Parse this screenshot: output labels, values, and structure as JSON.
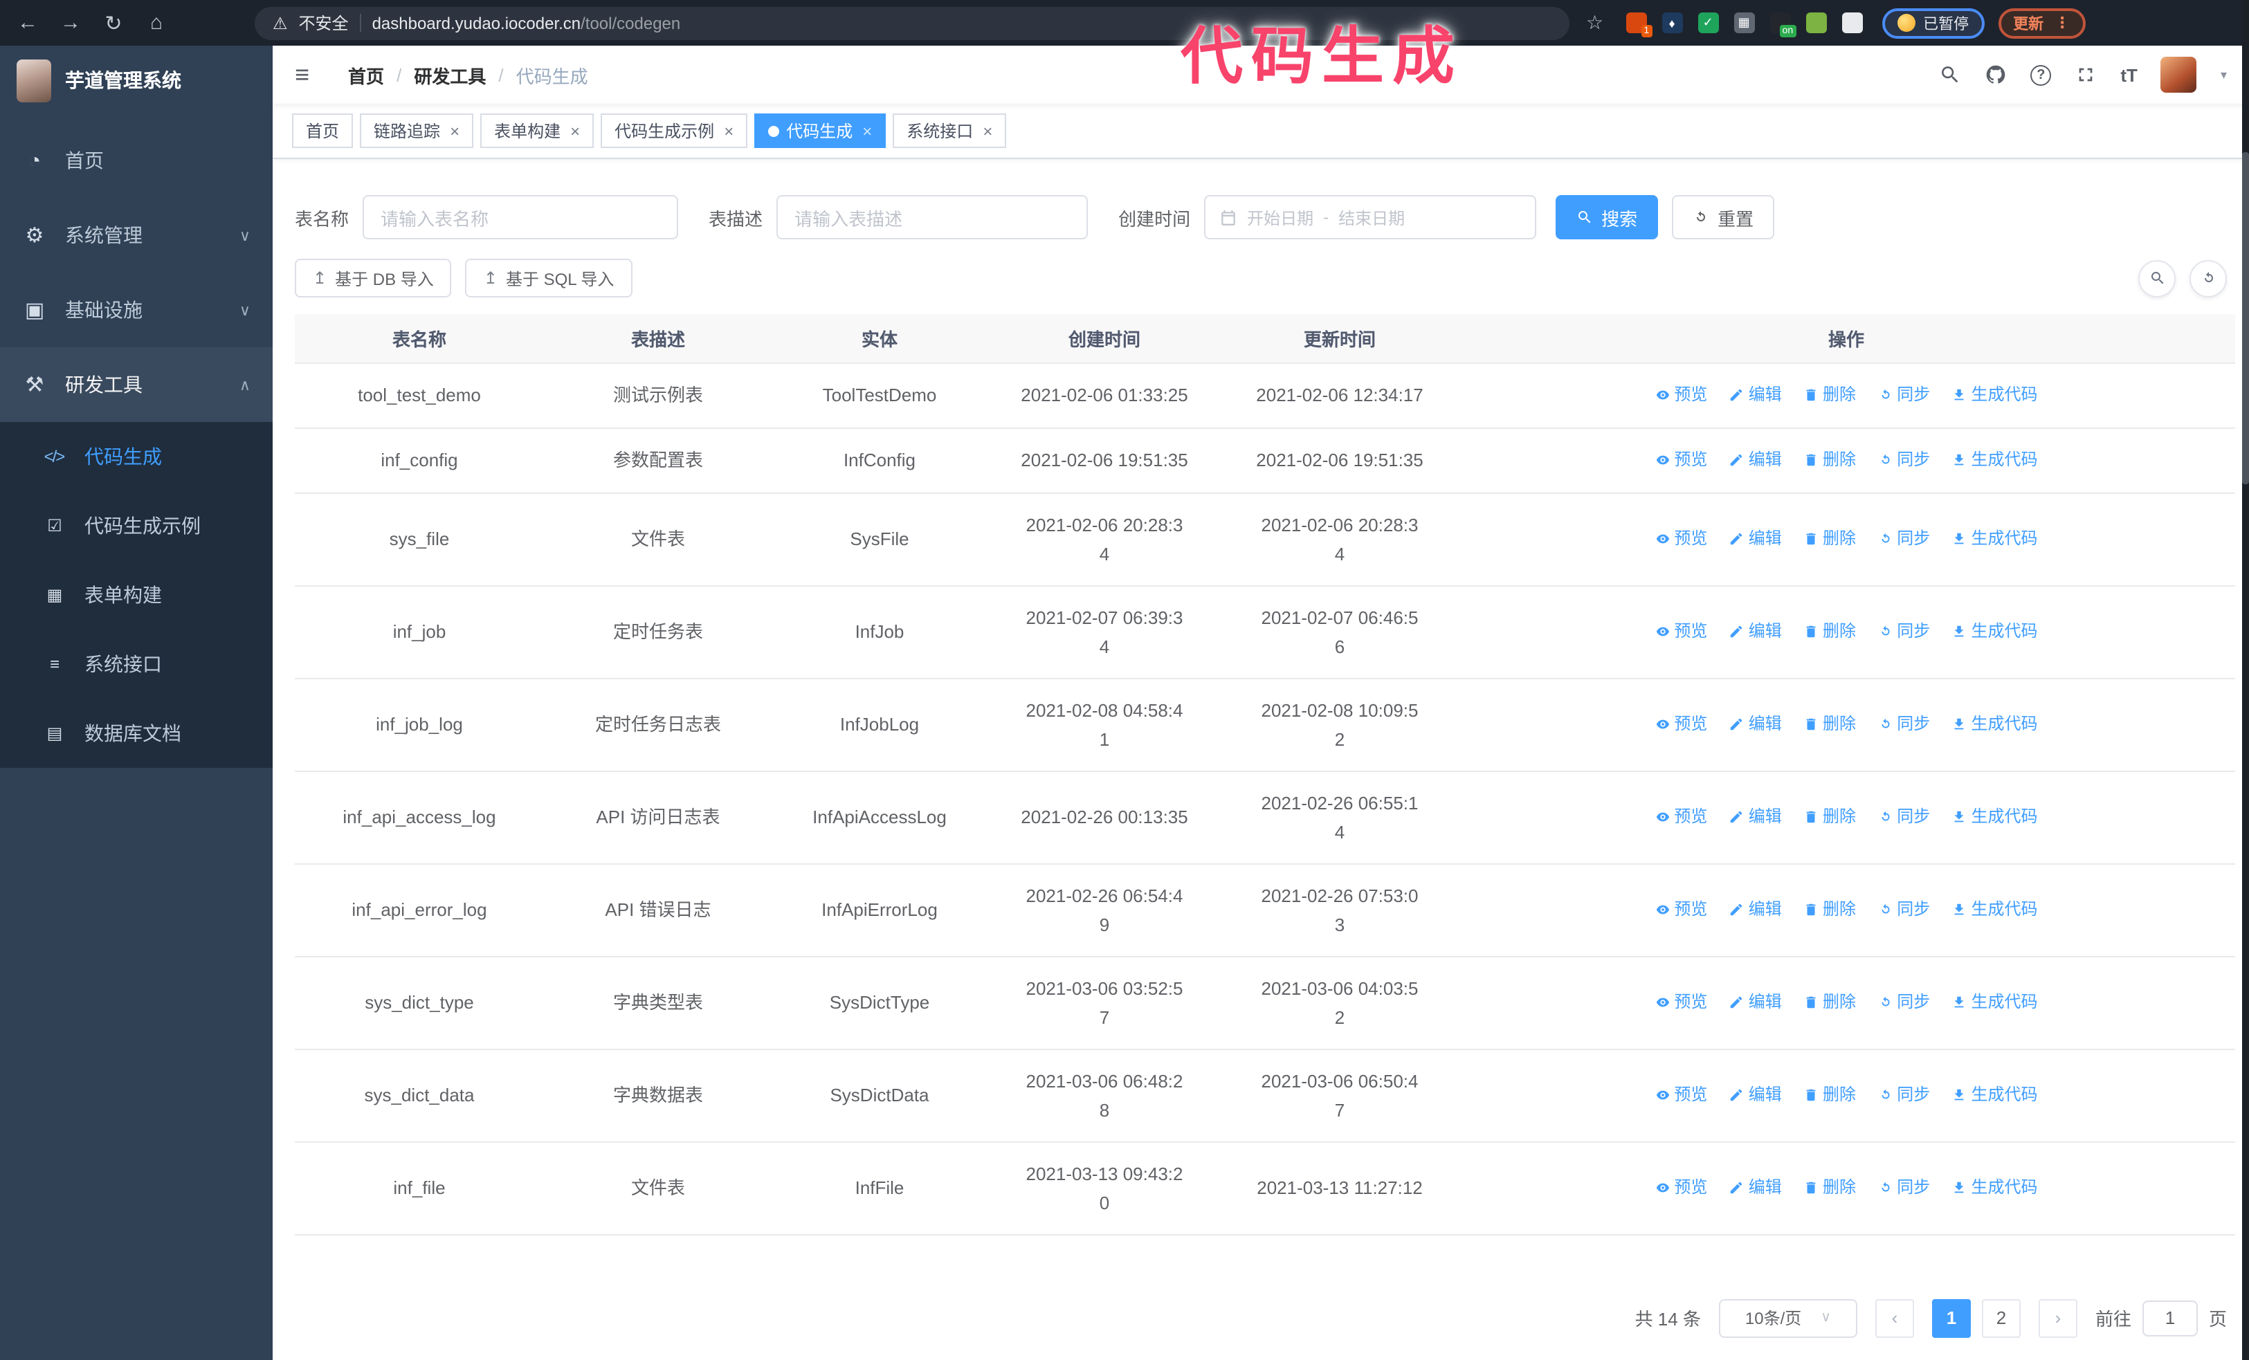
{
  "browser": {
    "security_label": "不安全",
    "url_host": "dashboard.yudao.iocoder.cn",
    "url_path": "/tool/codegen",
    "paused_badge": "已暂停",
    "update_button": "更新",
    "extensions": [
      {
        "name": "extension-loop-icon",
        "bg": "#d9480f",
        "badge": "1",
        "badge_bg": "#e8590c"
      },
      {
        "name": "extension-gem-icon",
        "bg": "#1e3a5f",
        "glyph": "♦"
      },
      {
        "name": "extension-check-icon",
        "bg": "#1fa45c",
        "glyph": "✓"
      },
      {
        "name": "extension-grid-icon",
        "bg": "#5f6772",
        "glyph": "▦"
      },
      {
        "name": "extension-on-badge-icon",
        "bg": "#23272d",
        "badge": "on",
        "badge_bg": "#2bab4e"
      },
      {
        "name": "extension-android-icon",
        "bg": "#7cb342"
      },
      {
        "name": "extension-puzzle-icon",
        "bg": "#e8eaed"
      }
    ]
  },
  "glyphs": {
    "back": "←",
    "forward": "→",
    "reload": "↻",
    "home": "⌂",
    "warning": "⚠",
    "star": "☆",
    "dots": "⋮",
    "hamburger": "≡",
    "caret_down": "▾",
    "close": "×",
    "prev": "‹",
    "next": "›",
    "select_caret": "∨",
    "upload": "↥"
  },
  "annotation": {
    "text": "代码生成",
    "color": "#f8436b"
  },
  "sidebar": {
    "logo_title": "芋道管理系统",
    "items": [
      {
        "label": "首页",
        "icon": "dashboard-icon",
        "glyph": "◔"
      },
      {
        "label": "系统管理",
        "icon": "gear-icon",
        "glyph": "⚙",
        "chevron_down": "∨"
      },
      {
        "label": "基础设施",
        "icon": "infrastructure-icon",
        "glyph": "▣",
        "chevron_down": "∨"
      },
      {
        "label": "研发工具",
        "icon": "toolbox-icon",
        "glyph": "⚒",
        "chevron_up": "∧",
        "active": true
      }
    ],
    "submenu": [
      {
        "label": "代码生成",
        "icon": "code-icon",
        "glyph": "</>",
        "active": true
      },
      {
        "label": "代码生成示例",
        "icon": "example-icon",
        "glyph": "☑"
      },
      {
        "label": "表单构建",
        "icon": "form-builder-icon",
        "glyph": "▦"
      },
      {
        "label": "系统接口",
        "icon": "api-icon",
        "glyph": "≡"
      },
      {
        "label": "数据库文档",
        "icon": "database-doc-icon",
        "glyph": "▤"
      }
    ]
  },
  "navbar": {
    "breadcrumb": [
      "首页",
      "研发工具",
      "代码生成"
    ],
    "separator": "/",
    "font_size_icon_label": "tT"
  },
  "tabs": [
    {
      "label": "首页"
    },
    {
      "label": "链路追踪",
      "closable": true
    },
    {
      "label": "表单构建",
      "closable": true
    },
    {
      "label": "代码生成示例",
      "closable": true
    },
    {
      "label": "代码生成",
      "closable": true,
      "active": true
    },
    {
      "label": "系统接口",
      "closable": true
    }
  ],
  "search_form": {
    "name_label": "表名称",
    "name_placeholder": "请输入表名称",
    "desc_label": "表描述",
    "desc_placeholder": "请输入表描述",
    "time_label": "创建时间",
    "start_placeholder": "开始日期",
    "range_separator": "-",
    "end_placeholder": "结束日期",
    "search_button": "搜索",
    "reset_button": "重置"
  },
  "toolbar": {
    "db_import_button": "基于 DB 导入",
    "sql_import_button": "基于 SQL 导入"
  },
  "table": {
    "columns": [
      "表名称",
      "表描述",
      "实体",
      "创建时间",
      "更新时间",
      "操作"
    ],
    "actions": [
      "预览",
      "编辑",
      "删除",
      "同步",
      "生成代码"
    ],
    "rows": [
      {
        "name": "tool_test_demo",
        "desc": "测试示例表",
        "entity": "ToolTestDemo",
        "created": "2021-02-06 01:33:25",
        "updated": "2021-02-06 12:34:17"
      },
      {
        "name": "inf_config",
        "desc": "参数配置表",
        "entity": "InfConfig",
        "created": "2021-02-06 19:51:35",
        "updated": "2021-02-06 19:51:35"
      },
      {
        "name": "sys_file",
        "desc": "文件表",
        "entity": "SysFile",
        "created": "2021-02-06 20:28:3\n4",
        "updated": "2021-02-06 20:28:3\n4"
      },
      {
        "name": "inf_job",
        "desc": "定时任务表",
        "entity": "InfJob",
        "created": "2021-02-07 06:39:3\n4",
        "updated": "2021-02-07 06:46:5\n6"
      },
      {
        "name": "inf_job_log",
        "desc": "定时任务日志表",
        "entity": "InfJobLog",
        "created": "2021-02-08 04:58:4\n1",
        "updated": "2021-02-08 10:09:5\n2"
      },
      {
        "name": "inf_api_access_log",
        "desc": "API 访问日志表",
        "entity": "InfApiAccessLog",
        "created": "2021-02-26 00:13:35",
        "updated": "2021-02-26 06:55:1\n4"
      },
      {
        "name": "inf_api_error_log",
        "desc": "API 错误日志",
        "entity": "InfApiErrorLog",
        "created": "2021-02-26 06:54:4\n9",
        "updated": "2021-02-26 07:53:0\n3"
      },
      {
        "name": "sys_dict_type",
        "desc": "字典类型表",
        "entity": "SysDictType",
        "created": "2021-03-06 03:52:5\n7",
        "updated": "2021-03-06 04:03:5\n2"
      },
      {
        "name": "sys_dict_data",
        "desc": "字典数据表",
        "entity": "SysDictData",
        "created": "2021-03-06 06:48:2\n8",
        "updated": "2021-03-06 06:50:4\n7"
      },
      {
        "name": "inf_file",
        "desc": "文件表",
        "entity": "InfFile",
        "created": "2021-03-13 09:43:2\n0",
        "updated": "2021-03-13 11:27:12"
      }
    ]
  },
  "pagination": {
    "total_label": "共 14 条",
    "page_size": "10条/页",
    "pages": [
      {
        "label": "1",
        "active": true
      },
      {
        "label": "2"
      }
    ],
    "goto_label": "前往",
    "goto_value": "1",
    "goto_suffix": "页"
  },
  "colors": {
    "accent": "#409eff",
    "sidebar_bg": "#304156",
    "submenu_bg": "#1f2d3d",
    "annotation_pink": "#f8436b"
  }
}
